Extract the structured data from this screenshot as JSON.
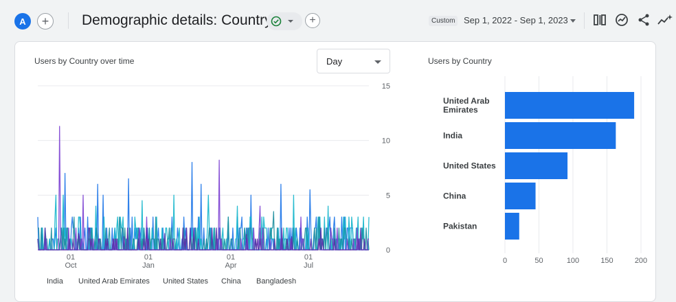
{
  "header": {
    "avatar_letter": "A",
    "add_label": "+",
    "title": "Demographic details: Country",
    "add_filter_label": "+",
    "date_chip": "Custom",
    "date_range": "Sep 1, 2022 - Sep 1, 2023",
    "tools": [
      "compare-icon",
      "insights-icon",
      "share-icon",
      "sparkle-icon"
    ]
  },
  "line_card": {
    "title": "Users by Country over time",
    "granularity": "Day"
  },
  "bar_card": {
    "title": "Users by Country"
  },
  "colors": {
    "accent": "#1a73e8",
    "bar": "#1a73e8"
  },
  "chart_data": [
    {
      "type": "line",
      "title": "Users by Country over time",
      "x_tick_labels": [
        [
          "01",
          "Oct"
        ],
        [
          "01",
          "Jan"
        ],
        [
          "01",
          "Apr"
        ],
        [
          "01",
          "Jul"
        ]
      ],
      "y_ticks": [
        0,
        5,
        10,
        15
      ],
      "ylim": [
        0,
        15
      ],
      "legend_position": "bottom",
      "series": [
        {
          "name": "India",
          "color": "#1a73e8",
          "peaks": [
            [
              30,
              7
            ],
            [
              66,
              6
            ],
            [
              72,
              5
            ],
            [
              100,
              6.5
            ],
            [
              170,
              8
            ],
            [
              180,
              6
            ],
            [
              235,
              5
            ],
            [
              268,
              6
            ],
            [
              300,
              5.5
            ]
          ]
        },
        {
          "name": "United Arab Emirates",
          "color": "#12b5cb",
          "peaks": [
            [
              20,
              5
            ],
            [
              28,
              5
            ],
            [
              64,
              4
            ],
            [
              115,
              4.5
            ],
            [
              150,
              5
            ],
            [
              188,
              5
            ],
            [
              220,
              4
            ],
            [
              282,
              5
            ],
            [
              320,
              4
            ]
          ]
        },
        {
          "name": "United States",
          "color": "#1e8e9e",
          "peaks": [
            [
              40,
              3
            ],
            [
              90,
              3
            ],
            [
              130,
              3
            ],
            [
              210,
              3
            ],
            [
              260,
              3.5
            ],
            [
              310,
              3
            ]
          ]
        },
        {
          "name": "China",
          "color": "#7b3fd1",
          "peaks": [
            [
              24,
              11.3
            ],
            [
              50,
              5
            ],
            [
              120,
              3
            ],
            [
              200,
              8.2
            ],
            [
              245,
              4
            ],
            [
              290,
              3
            ]
          ]
        },
        {
          "name": "Bangladesh",
          "color": "#5b2ca8",
          "peaks": [
            [
              45,
              1.5
            ],
            [
              95,
              1.2
            ],
            [
              140,
              1.5
            ],
            [
              230,
              1.4
            ],
            [
              280,
              1.2
            ]
          ]
        }
      ]
    },
    {
      "type": "bar",
      "title": "Users by Country",
      "orientation": "horizontal",
      "categories": [
        "United Arab Emirates",
        "India",
        "United States",
        "China",
        "Pakistan"
      ],
      "values": [
        190,
        163,
        92,
        45,
        21
      ],
      "x_ticks": [
        0,
        50,
        100,
        150,
        200
      ],
      "xlim": [
        0,
        200
      ],
      "grid": true
    }
  ]
}
